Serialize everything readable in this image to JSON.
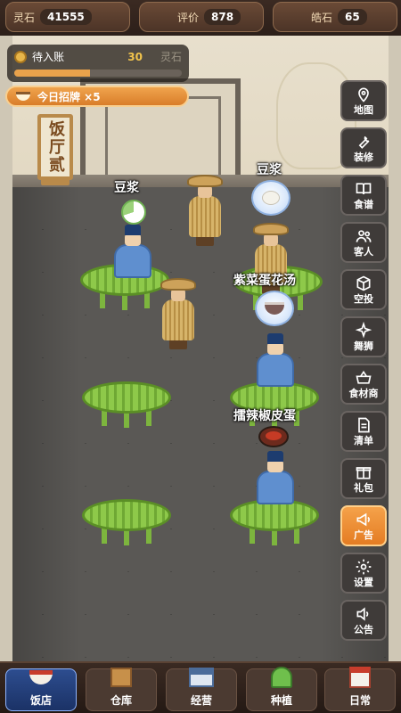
{
  "resources": [
    {
      "label": "灵石",
      "value": "41555"
    },
    {
      "label": "评价",
      "value": "878"
    },
    {
      "label": "皓石",
      "value": "65"
    }
  ],
  "pending": {
    "label": "待入账",
    "count": "30",
    "unit": "灵石",
    "progress_percent": 45
  },
  "recruit": {
    "label": "今日招牌 ×5"
  },
  "hall_sign": "饭厅贰",
  "orders": [
    {
      "name": "豆浆"
    },
    {
      "name": "豆浆"
    },
    {
      "name": "紫菜蛋花汤"
    },
    {
      "name": "擂辣椒皮蛋"
    }
  ],
  "side_menu": [
    {
      "label": "地图",
      "icon": "map-pin-icon"
    },
    {
      "label": "装修",
      "icon": "wrench-icon"
    },
    {
      "label": "食谱",
      "icon": "book-icon"
    },
    {
      "label": "客人",
      "icon": "users-icon"
    },
    {
      "label": "空投",
      "icon": "box-icon"
    },
    {
      "label": "舞狮",
      "icon": "sparkle-icon"
    },
    {
      "label": "食材商",
      "icon": "basket-icon"
    },
    {
      "label": "清单",
      "icon": "list-icon"
    },
    {
      "label": "礼包",
      "icon": "gift-icon"
    },
    {
      "label": "广告",
      "icon": "megaphone-icon",
      "active": true
    },
    {
      "label": "设置",
      "icon": "gear-icon"
    },
    {
      "label": "公告",
      "icon": "speaker-icon"
    }
  ],
  "bottom_nav": [
    {
      "label": "饭店",
      "icon": "bowl-icon",
      "active": true
    },
    {
      "label": "仓库",
      "icon": "crate-icon"
    },
    {
      "label": "经营",
      "icon": "shop-icon"
    },
    {
      "label": "种植",
      "icon": "sprout-icon"
    },
    {
      "label": "日常",
      "icon": "calendar-icon"
    }
  ],
  "colors": {
    "accent_orange": "#e47c23",
    "nav_active": "#2d4d8f",
    "table_green": "#8ec94a"
  }
}
